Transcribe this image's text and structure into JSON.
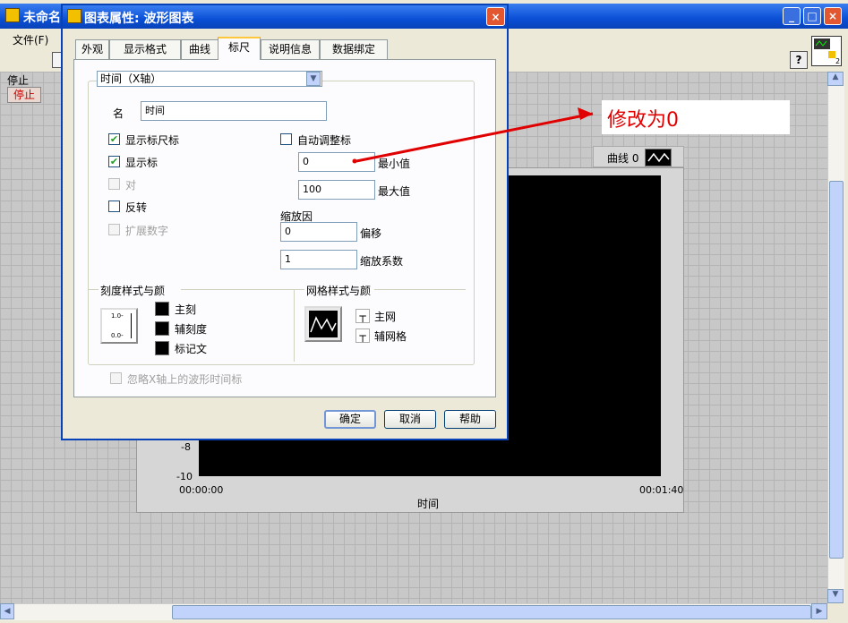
{
  "background_window": {
    "title": "未命名",
    "menu_file": "文件(F)",
    "stop_label": "停止",
    "stop_button": "停止",
    "help_icon": "?"
  },
  "chart": {
    "legend_label": "曲线 0",
    "x_axis_label": "时间",
    "y_ticks": [
      "-8",
      "-10"
    ],
    "x_ticks": [
      "00:00:00",
      "00:01:40"
    ]
  },
  "annotation": {
    "text": "修改为0",
    "color": "#e00000"
  },
  "dialog": {
    "title": "图表属性: 波形图表",
    "close_icon": "×",
    "tabs": [
      {
        "label": "外观"
      },
      {
        "label": "显示格式"
      },
      {
        "label": "曲线"
      },
      {
        "label": "标尺"
      },
      {
        "label": "说明信息"
      },
      {
        "label": "数据绑定"
      }
    ],
    "active_tab": "标尺",
    "axis_select": "时间（X轴）",
    "name_label": "名",
    "name_value": "时间",
    "show_scale_label": {
      "label": "显示标尺标",
      "checked": true
    },
    "show_scale": {
      "label": "显示标",
      "checked": true
    },
    "log": {
      "label": "对",
      "checked": false,
      "disabled": true
    },
    "invert": {
      "label": "反转",
      "checked": false
    },
    "expand_digital": {
      "label": "扩展数字",
      "checked": false,
      "disabled": true
    },
    "autoscale": {
      "label": "自动调整标",
      "checked": false
    },
    "min_value": "0",
    "min_label": "最小值",
    "max_value": "100",
    "max_label": "最大值",
    "scaling_title": "缩放因",
    "offset_value": "0",
    "offset_label": "偏移",
    "multiplier_value": "1",
    "multiplier_label": "缩放系数",
    "tick_style_title": "刻度样式与颜",
    "tick_style_icon_top": "1.0-",
    "tick_style_icon_bottom": "0.0-",
    "major_tick": "主刻",
    "minor_tick": "辅刻度",
    "marker_text": "标记文",
    "grid_style_title": "网格样式与颜",
    "major_grid": "主网",
    "minor_grid": "辅网格",
    "grid_icon_glyph": "┬",
    "ignore_timestamp": {
      "label": "忽略X轴上的波形时间标",
      "checked": false,
      "disabled": true
    },
    "ok_label": "确定",
    "cancel_label": "取消",
    "help_label": "帮助"
  }
}
